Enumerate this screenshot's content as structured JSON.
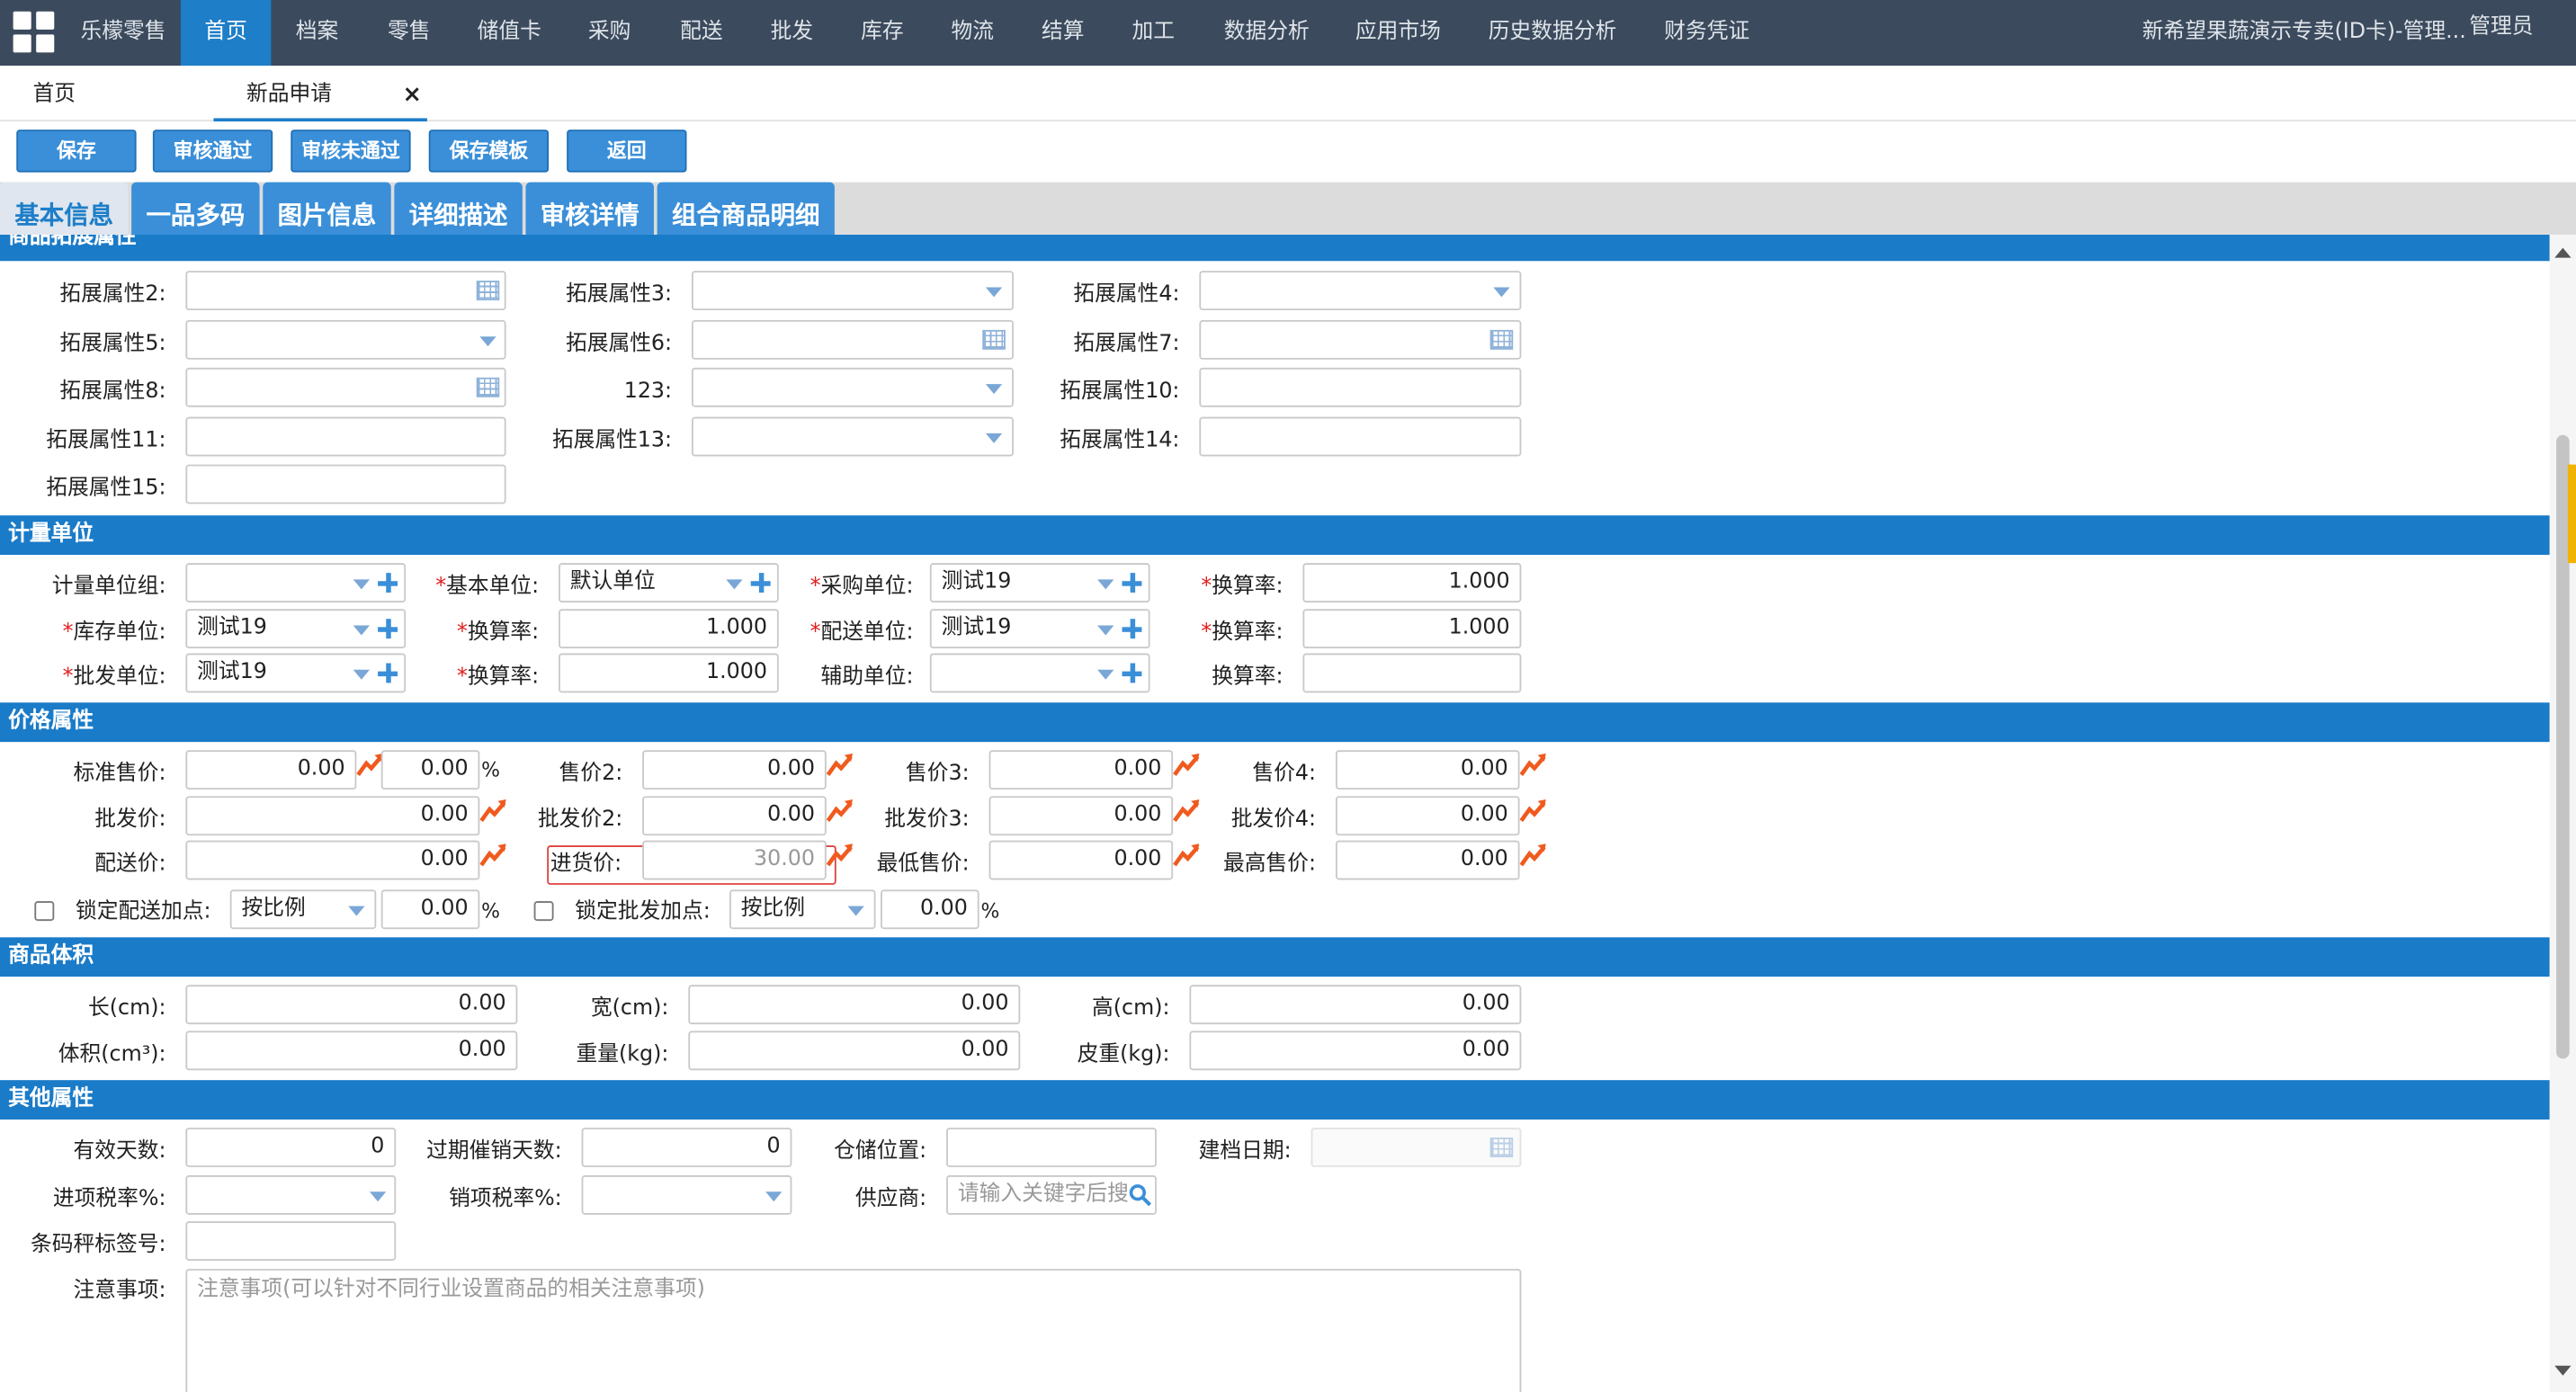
{
  "topnav": {
    "items": [
      "乐檬零售",
      "首页",
      "档案",
      "零售",
      "储值卡",
      "采购",
      "配送",
      "批发",
      "库存",
      "物流",
      "结算",
      "加工",
      "数据分析",
      "应用市场",
      "历史数据分析",
      "财务凭证"
    ],
    "account": "新希望果蔬演示专卖(ID卡)-管理...",
    "user": "管理员"
  },
  "page_tabs": {
    "home": "首页",
    "current": "新品申请",
    "close": "×"
  },
  "toolbar": {
    "save": "保存",
    "approve": "审核通过",
    "reject": "审核未通过",
    "save_template": "保存模板",
    "back": "返回"
  },
  "sub_tabs": [
    "基本信息",
    "一品多码",
    "图片信息",
    "详细描述",
    "审核详情",
    "组合商品明细"
  ],
  "sections": {
    "ext": "商品拓展属性",
    "unit": "计量单位",
    "price": "价格属性",
    "volume": "商品体积",
    "other": "其他属性"
  },
  "ext": {
    "labels": [
      "拓展属性2:",
      "拓展属性3:",
      "拓展属性4:",
      "拓展属性5:",
      "拓展属性6:",
      "拓展属性7:",
      "拓展属性8:",
      "123:",
      "拓展属性10:",
      "拓展属性11:",
      "拓展属性13:",
      "拓展属性14:",
      "拓展属性15:"
    ]
  },
  "unit": {
    "unit_group": "计量单位组:",
    "base_unit": "基本单位:",
    "base_unit_value": "默认单位",
    "purchase_unit": "采购单位:",
    "purchase_unit_value": "测试19",
    "rate": "换算率:",
    "rate_value": "1.000",
    "stock_unit": "库存单位:",
    "stock_unit_value": "测试19",
    "dist_unit": "配送单位:",
    "dist_unit_value": "测试19",
    "wholesale_unit": "批发单位:",
    "wholesale_unit_value": "测试19",
    "aux_unit": "辅助单位:"
  },
  "price": {
    "std_price": "标准售价:",
    "std_value": "0.00",
    "std_pct": "0.00",
    "pct": "%",
    "price2": "售价2:",
    "price3": "售价3:",
    "price4": "售价4:",
    "wholesale": "批发价:",
    "wholesale2": "批发价2:",
    "wholesale3": "批发价3:",
    "wholesale4": "批发价4:",
    "dist_price": "配送价:",
    "purchase_price": "进货价:",
    "purchase_value": "30.00",
    "min_price": "最低售价:",
    "max_price": "最高售价:",
    "zero": "0.00",
    "lock_dist": "锁定配送加点:",
    "lock_wholesale": "锁定批发加点:",
    "by_ratio": "按比例"
  },
  "volume": {
    "length": "长(cm):",
    "width": "宽(cm):",
    "height": "高(cm):",
    "volume": "体积(cm³):",
    "weight": "重量(kg):",
    "tare": "皮重(kg):",
    "zero": "0.00"
  },
  "other": {
    "valid_days": "有效天数:",
    "valid_value": "0",
    "expire_days": "过期催销天数:",
    "expire_value": "0",
    "storage": "仓储位置:",
    "created": "建档日期:",
    "input_tax": "进项税率%:",
    "output_tax": "销项税率%:",
    "supplier": "供应商:",
    "supplier_placeholder": "请输入关键字后搜",
    "barcode": "条码秤标签号:",
    "notes": "注意事项:",
    "notes_placeholder": "注意事项(可以针对不同行业设置商品的相关注意事项)"
  },
  "colors": {
    "nav": "#3b4a5c",
    "accent": "#1e7ec8",
    "section": "#1a7bc8",
    "trend": "#f05a1e"
  }
}
